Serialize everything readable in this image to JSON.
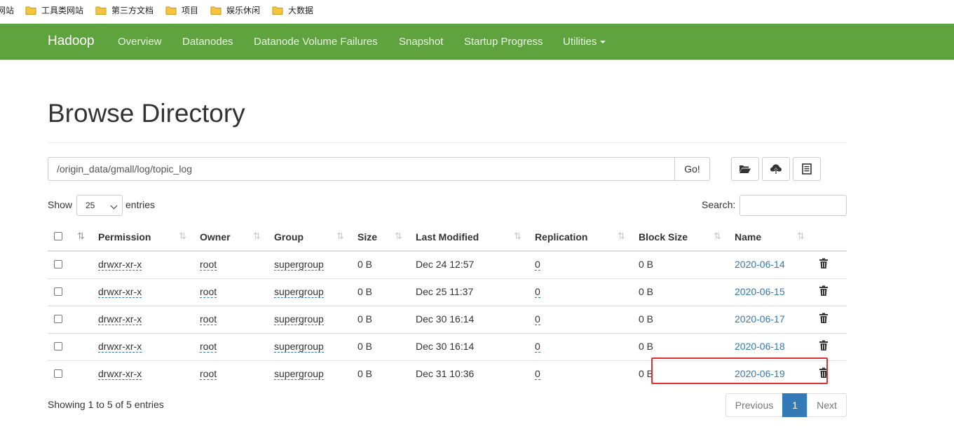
{
  "bookmarks": [
    {
      "label": "网站"
    },
    {
      "label": "工具类网站"
    },
    {
      "label": "第三方文档"
    },
    {
      "label": "项目"
    },
    {
      "label": "娱乐休闲"
    },
    {
      "label": "大数据"
    }
  ],
  "navbar": {
    "brand": "Hadoop",
    "items": [
      "Overview",
      "Datanodes",
      "Datanode Volume Failures",
      "Snapshot",
      "Startup Progress",
      "Utilities"
    ]
  },
  "page": {
    "title": "Browse Directory",
    "path_value": "/origin_data/gmall/log/topic_log",
    "go_label": "Go!",
    "show_label": "Show",
    "entries_value": "25",
    "entries_label": "entries",
    "search_label": "Search:",
    "search_value": ""
  },
  "table": {
    "headers": [
      "Permission",
      "Owner",
      "Group",
      "Size",
      "Last Modified",
      "Replication",
      "Block Size",
      "Name"
    ],
    "rows": [
      {
        "permission": "drwxr-xr-x",
        "owner": "root",
        "group": "supergroup",
        "size": "0 B",
        "modified": "Dec 24 12:57",
        "replication": "0",
        "block_size": "0 B",
        "name": "2020-06-14"
      },
      {
        "permission": "drwxr-xr-x",
        "owner": "root",
        "group": "supergroup",
        "size": "0 B",
        "modified": "Dec 25 11:37",
        "replication": "0",
        "block_size": "0 B",
        "name": "2020-06-15"
      },
      {
        "permission": "drwxr-xr-x",
        "owner": "root",
        "group": "supergroup",
        "size": "0 B",
        "modified": "Dec 30 16:14",
        "replication": "0",
        "block_size": "0 B",
        "name": "2020-06-17"
      },
      {
        "permission": "drwxr-xr-x",
        "owner": "root",
        "group": "supergroup",
        "size": "0 B",
        "modified": "Dec 30 16:14",
        "replication": "0",
        "block_size": "0 B",
        "name": "2020-06-18"
      },
      {
        "permission": "drwxr-xr-x",
        "owner": "root",
        "group": "supergroup",
        "size": "0 B",
        "modified": "Dec 31 10:36",
        "replication": "0",
        "block_size": "0 B",
        "name": "2020-06-19"
      }
    ]
  },
  "footer": {
    "showing": "Showing 1 to 5 of 5 entries",
    "previous": "Previous",
    "page": "1",
    "next": "Next"
  },
  "colors": {
    "navbar": "#5fa33e",
    "link": "#337ab7",
    "highlight": "#e03030",
    "active_page": "#337ab7"
  },
  "icons": [
    "folder-icon",
    "folder-open-icon",
    "cloud-upload-icon",
    "list-icon",
    "trash-icon",
    "sort-icon",
    "caret-down-icon"
  ]
}
